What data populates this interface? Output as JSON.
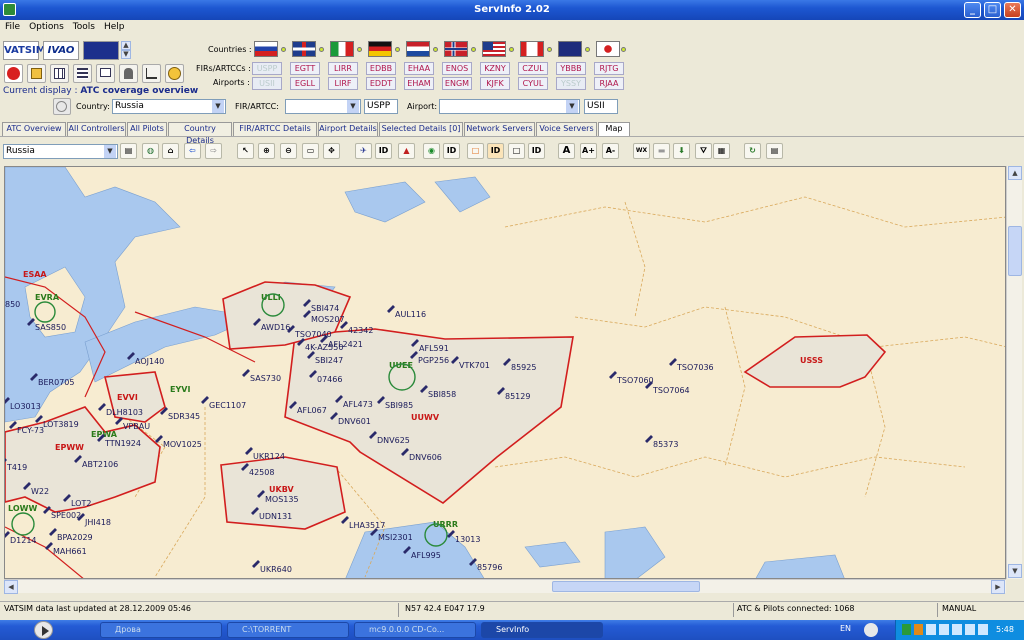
{
  "window": {
    "title": "ServInfo 2.02"
  },
  "menu": [
    "File",
    "Options",
    "Tools",
    "Help"
  ],
  "logos": {
    "vatsim": "VATSIM",
    "ivao": "IVAO"
  },
  "labels": {
    "countries": "Countries :",
    "firs": "FIRs/ARTCCs :",
    "airports": "Airports :",
    "current_display": "Current display :",
    "current_value": "ATC coverage overview",
    "country": "Country:",
    "fir_artcc": "FIR/ARTCC:",
    "airport": "Airport:"
  },
  "countries": [
    "russia",
    "uk",
    "italy",
    "germany",
    "netherlands",
    "norway",
    "usa",
    "canada",
    "australia",
    "japan"
  ],
  "firs": [
    "USPP",
    "EGTT",
    "LIRR",
    "EDBB",
    "EHAA",
    "ENOS",
    "KZNY",
    "CZUL",
    "YBBB",
    "RJTG"
  ],
  "airports": [
    "USII",
    "EGLL",
    "LIRF",
    "EDDT",
    "EHAM",
    "ENGM",
    "KJFK",
    "CYUL",
    "YSSY",
    "RJAA"
  ],
  "filters": {
    "country_value": "Russia",
    "fir_value": "",
    "fir_code": "USPP",
    "airport_value": "",
    "airport_code": "USII"
  },
  "tabs": [
    "ATC Overview",
    "All Controllers",
    "All Pilots",
    "Country Details",
    "FIR/ARTCC Details",
    "Airport Details",
    "Selected Details [0]",
    "Network Servers",
    "Voice Servers",
    "Map"
  ],
  "active_tab": "Map",
  "map_toolbar": {
    "region": "Russia",
    "id1": "ID",
    "id2": "ID",
    "id3": "ID",
    "id4": "ID",
    "a1": "A",
    "a2": "A+",
    "a3": "A-",
    "wx": "WX"
  },
  "map": {
    "region_labels": [
      "ESAA",
      "EVVI",
      "EYVI",
      "EPWA",
      "EPWW",
      "UUWV",
      "UUEE",
      "ULLI",
      "USSS",
      "URRR",
      "UKBV",
      "LOWW",
      "EVRA"
    ],
    "callsigns": [
      "AUL116",
      "SBI474",
      "MOS207",
      "42342",
      "AFL2421",
      "AFL591",
      "PGP256",
      "VTK701",
      "85925",
      "85129",
      "SBI858",
      "SBI247",
      "SAS730",
      "07466",
      "AFL067",
      "DNV601",
      "DNV625",
      "DNV606",
      "AFL473",
      "SBI985",
      "GEC1107",
      "SDR345",
      "MOV1025",
      "TTN1924",
      "VPBAU",
      "ABT2106",
      "LOT2",
      "SPE002",
      "JHI418",
      "BPA2029",
      "MAH661",
      "LOT3819",
      "FCY-73",
      "LO3013",
      "DLH8103",
      "AOJ140",
      "BER0705",
      "UKR124",
      "42508",
      "MOS135",
      "UDN131",
      "LHA3517",
      "MSI2301",
      "AFL995",
      "13013",
      "85796",
      "UKR640",
      "TSO7036",
      "TSO7060",
      "TSO7064",
      "85373",
      "4K-AZ550",
      "AWD16",
      "SAS850",
      "850",
      "T419",
      "W22",
      "D1214",
      "TSO7040"
    ]
  },
  "status": {
    "updated": "VATSIM data last updated at 28.12.2009 05:46",
    "coords": "N57 42.4  E047 17.9",
    "connected": "ATC & Pilots connected: 1068",
    "mode": "MANUAL"
  },
  "taskbar": {
    "tasks": [
      "Дрова",
      "C:\\TORRENT",
      "mc9.0.0.0 CD-Co...",
      "ServInfo"
    ],
    "lang": "EN",
    "clock": "5:48"
  },
  "colors": {
    "accent": "#1d57d1",
    "fir_border": "#d21e1e",
    "water": "#a9c8ee",
    "land": "#f7ecd1",
    "fir_fill": "#e9e4d7"
  }
}
